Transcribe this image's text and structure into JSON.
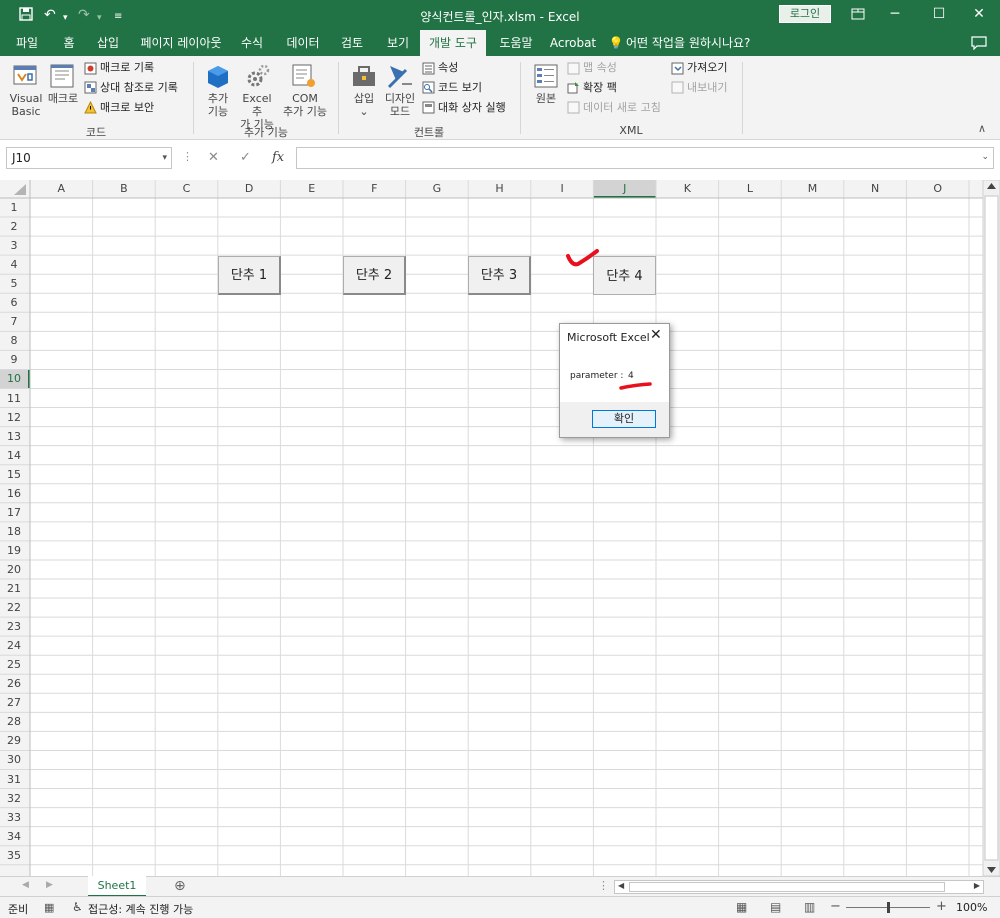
{
  "window": {
    "title": "양식컨트롤_인자.xlsm - Excel",
    "login_label": "로그인"
  },
  "tabs": [
    "파일",
    "홈",
    "삽입",
    "페이지 레이아웃",
    "수식",
    "데이터",
    "검토",
    "보기",
    "개발 도구",
    "도움말",
    "Acrobat"
  ],
  "tell_me": "어떤 작업을 원하시나요?",
  "ribbon": {
    "code": {
      "visual_basic": [
        "Visual",
        "Basic"
      ],
      "macro": "매크로",
      "record_macro": "매크로 기록",
      "relative_ref": "상대 참조로 기록",
      "macro_security": "매크로 보안",
      "name": "코드"
    },
    "addins": {
      "addins": [
        "추가",
        "기능"
      ],
      "excel_addins": [
        "Excel 추",
        "가 기능"
      ],
      "com_addins": [
        "COM",
        "추가 기능"
      ],
      "name": "추가 기능"
    },
    "controls": {
      "insert": "삽입",
      "design_mode": [
        "디자인",
        "모드"
      ],
      "properties": "속성",
      "view_code": "코드 보기",
      "run_dialog": "대화 상자 실행",
      "name": "컨트롤"
    },
    "xml": {
      "source": "원본",
      "map_properties": "맵 속성",
      "expansion_packs": "확장 팩",
      "refresh_data": "데이터 새로 고침",
      "import": "가져오기",
      "export": "내보내기",
      "name": "XML"
    }
  },
  "formula_bar": {
    "name_box": "J10",
    "fx": "fx",
    "formula": ""
  },
  "columns": [
    "A",
    "B",
    "C",
    "D",
    "E",
    "F",
    "G",
    "H",
    "I",
    "J",
    "K",
    "L",
    "M",
    "N",
    "O"
  ],
  "rows": [
    "1",
    "2",
    "3",
    "4",
    "5",
    "6",
    "7",
    "8",
    "9",
    "10",
    "11",
    "12",
    "13",
    "14",
    "15",
    "16",
    "17",
    "18",
    "19",
    "20",
    "21",
    "22",
    "23",
    "24",
    "25",
    "26",
    "27",
    "28",
    "29",
    "30",
    "31",
    "32",
    "33",
    "34",
    "35"
  ],
  "selected": {
    "col": "J",
    "row": "10"
  },
  "buttons": [
    "단추 1",
    "단추 2",
    "단추 3",
    "단추 4"
  ],
  "dialog": {
    "title": "Microsoft Excel",
    "message_label": "parameter :",
    "message_value": "4",
    "ok_label": "확인"
  },
  "sheets": [
    "Sheet1"
  ],
  "status": {
    "ready": "준비",
    "accessibility": "접근성: 계속 진행 가능",
    "zoom": "100%"
  },
  "colors": {
    "brand": "#217346",
    "annotation": "#e8101e"
  }
}
